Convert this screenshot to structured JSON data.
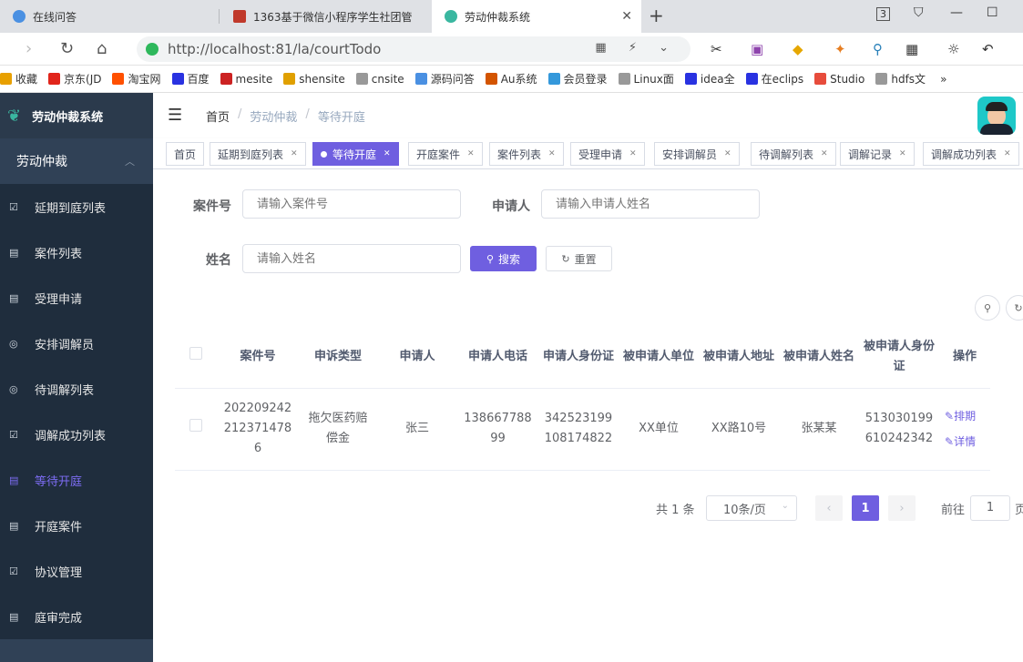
{
  "browser": {
    "tabs": [
      {
        "title": "在线问答",
        "color": "#4a90e2"
      },
      {
        "title": "1363基于微信小程序学生社团管",
        "color": "#c0392b"
      },
      {
        "title": "劳动仲裁系统",
        "color": "#3ab7a0"
      }
    ],
    "url": "http://localhost:81/la/courtTodo",
    "bookmarks": [
      {
        "label": "收藏",
        "color": "#e8a000"
      },
      {
        "label": "京东(JD",
        "color": "#e1251b"
      },
      {
        "label": "淘宝网",
        "color": "#ff5000"
      },
      {
        "label": "百度",
        "color": "#2932e1"
      },
      {
        "label": "mesite",
        "color": "#cc2222"
      },
      {
        "label": "shensite",
        "color": "#e0a000"
      },
      {
        "label": "cnsite",
        "color": "#999999"
      },
      {
        "label": "源码问答",
        "color": "#4a90e2"
      },
      {
        "label": "Au系统",
        "color": "#d35400"
      },
      {
        "label": "会员登录",
        "color": "#3498db"
      },
      {
        "label": "Linux面",
        "color": "#999999"
      },
      {
        "label": "idea全",
        "color": "#2932e1"
      },
      {
        "label": "在eclips",
        "color": "#2932e1"
      },
      {
        "label": "Studio",
        "color": "#e74c3c"
      },
      {
        "label": "hdfs文",
        "color": "#999999"
      }
    ],
    "more": "»"
  },
  "app": {
    "title": "劳动仲裁系统",
    "menu_group": "劳动仲裁",
    "menu": [
      {
        "label": "延期到庭列表",
        "icon": "☑"
      },
      {
        "label": "案件列表",
        "icon": "▤"
      },
      {
        "label": "受理申请",
        "icon": "▤"
      },
      {
        "label": "安排调解员",
        "icon": "◎"
      },
      {
        "label": "待调解列表",
        "icon": "◎"
      },
      {
        "label": "调解成功列表",
        "icon": "☑"
      },
      {
        "label": "等待开庭",
        "icon": "▤"
      },
      {
        "label": "开庭案件",
        "icon": "▤"
      },
      {
        "label": "协议管理",
        "icon": "☑"
      },
      {
        "label": "庭审完成",
        "icon": "▤"
      }
    ],
    "active_menu_index": 6
  },
  "breadcrumb": [
    "首页",
    "劳动仲裁",
    "等待开庭"
  ],
  "tags": [
    {
      "label": "首页",
      "closable": false
    },
    {
      "label": "延期到庭列表",
      "closable": true
    },
    {
      "label": "等待开庭",
      "closable": true,
      "active": true
    },
    {
      "label": "开庭案件",
      "closable": true
    },
    {
      "label": "案件列表",
      "closable": true
    },
    {
      "label": "受理申请",
      "closable": true
    },
    {
      "label": "安排调解员",
      "closable": true
    },
    {
      "label": "待调解列表",
      "closable": true
    },
    {
      "label": "调解记录",
      "closable": true
    },
    {
      "label": "调解成功列表",
      "closable": true
    }
  ],
  "search": {
    "case_no_label": "案件号",
    "case_no_placeholder": "请输入案件号",
    "applicant_label": "申请人",
    "applicant_placeholder": "请输入申请人姓名",
    "name_label": "姓名",
    "name_placeholder": "请输入姓名",
    "search_button": "搜索",
    "reset_button": "重置"
  },
  "table": {
    "headers": [
      "案件号",
      "申诉类型",
      "申请人",
      "申请人电话",
      "申请人身份证",
      "被申请人单位",
      "被申请人地址",
      "被申请人姓名",
      "被申请人身份证",
      "操作"
    ],
    "rows": [
      {
        "cells": [
          "2022092422123714786",
          "拖欠医药赔偿金",
          "张三",
          "13866778899",
          "342523199108174822",
          "XX单位",
          "XX路10号",
          "张某某",
          "513030199610242342"
        ],
        "actions": [
          "排期",
          "详情"
        ]
      }
    ]
  },
  "pagination": {
    "total_text": "共 1 条",
    "page_size": "10条/页",
    "current_page": "1",
    "goto_label": "前往",
    "goto_value": "1",
    "page_suffix": "页"
  }
}
